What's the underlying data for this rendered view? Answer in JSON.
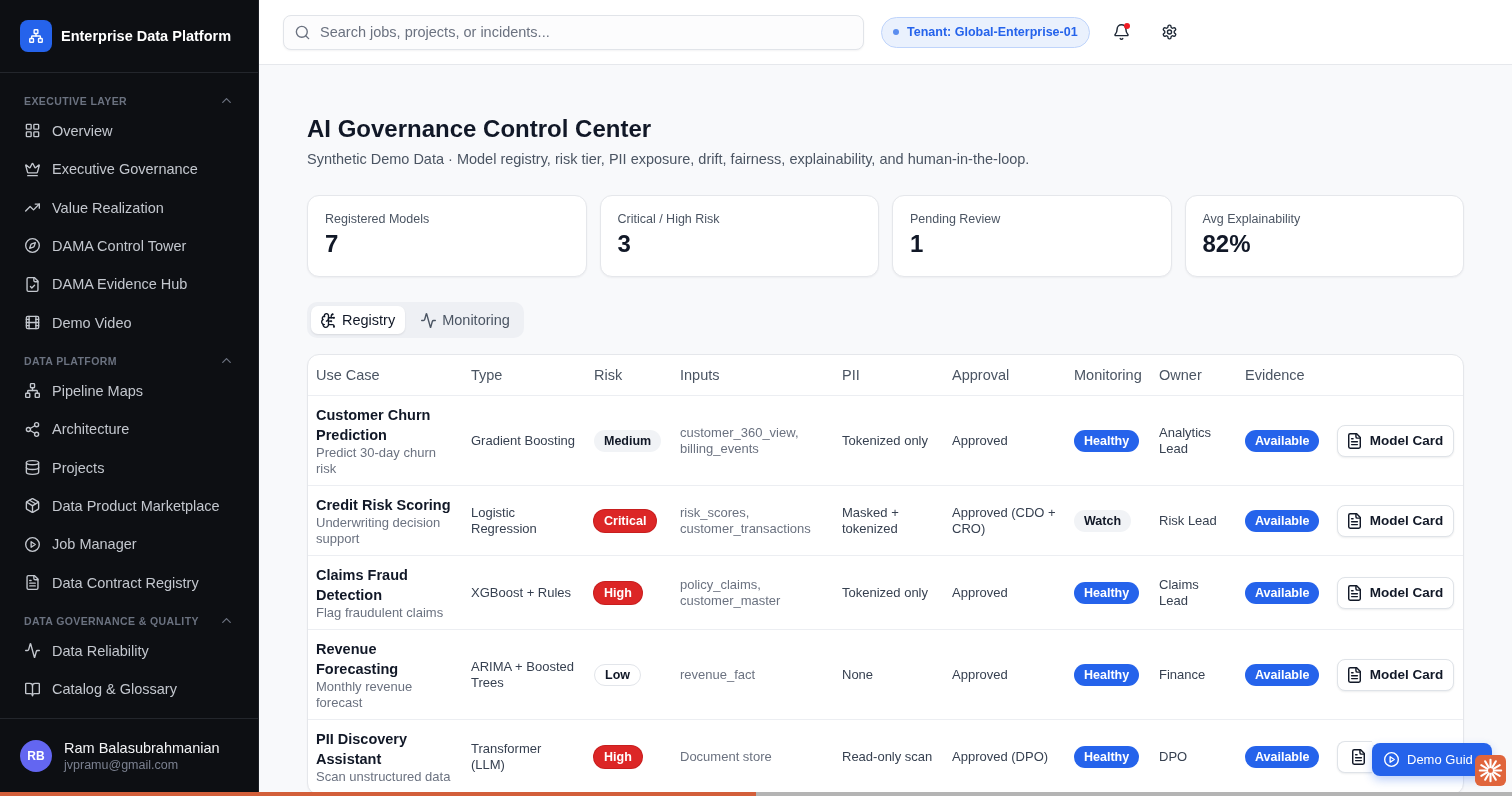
{
  "sidebar": {
    "brand": "Enterprise Data Platform",
    "sections": [
      {
        "title": "EXECUTIVE LAYER",
        "expanded": true,
        "items": [
          {
            "label": "Overview",
            "selected": false
          },
          {
            "label": "Executive Governance",
            "selected": false
          },
          {
            "label": "Value Realization",
            "selected": false
          },
          {
            "label": "DAMA Control Tower",
            "selected": false
          },
          {
            "label": "DAMA Evidence Hub",
            "selected": false
          },
          {
            "label": "Demo Video",
            "selected": false
          }
        ]
      },
      {
        "title": "DATA PLATFORM",
        "expanded": true,
        "items": [
          {
            "label": "Pipeline Maps",
            "selected": false
          },
          {
            "label": "Architecture",
            "selected": false
          },
          {
            "label": "Projects",
            "selected": false
          },
          {
            "label": "Data Product Marketplace",
            "selected": false
          },
          {
            "label": "Job Manager",
            "selected": false
          },
          {
            "label": "Data Contract Registry",
            "selected": false
          }
        ]
      },
      {
        "title": "DATA GOVERNANCE & QUALITY",
        "expanded": true,
        "items": [
          {
            "label": "Data Reliability",
            "selected": false
          },
          {
            "label": "Catalog & Glossary",
            "selected": false
          }
        ]
      }
    ],
    "user": {
      "initials": "RB",
      "name": "Ram Balasubrahmanian",
      "email": "jvpramu@gmail.com"
    }
  },
  "topbar": {
    "search": {
      "placeholder": "Search jobs, projects, or incidents..."
    },
    "tenant": "Tenant: Global-Enterprise-01",
    "notifications": {
      "unread": true
    }
  },
  "page": {
    "title": "AI Governance Control Center",
    "subtitle": "Synthetic Demo Data · Model registry, risk tier, PII exposure, drift, fairness, explainability, and human-in-the-loop."
  },
  "stats": [
    {
      "label": "Registered Models",
      "value": "7"
    },
    {
      "label": "Critical / High Risk",
      "value": "3"
    },
    {
      "label": "Pending Review",
      "value": "1"
    },
    {
      "label": "Avg Explainability",
      "value": "82%"
    }
  ],
  "tabs": [
    {
      "label": "Registry",
      "selected": true
    },
    {
      "label": "Monitoring",
      "selected": false
    }
  ],
  "table": {
    "columns": [
      "Use Case",
      "Type",
      "Risk",
      "Inputs",
      "PII",
      "Approval",
      "Monitoring",
      "Owner",
      "Evidence"
    ],
    "rows": [
      {
        "use_case": {
          "title": "Customer Churn Prediction",
          "description": "Predict 30-day churn risk"
        },
        "type": "Gradient Boosting",
        "risk": {
          "label": "Medium",
          "kind": "muted"
        },
        "inputs": "customer_360_view, billing_events",
        "pii": "Tokenized only",
        "approval": "Approved",
        "monitoring": {
          "label": "Healthy",
          "kind": "primary"
        },
        "owner": "Analytics Lead",
        "evidence": {
          "label": "Available",
          "kind": "primary"
        },
        "action": "Model Card"
      },
      {
        "use_case": {
          "title": "Credit Risk Scoring",
          "description": "Underwriting decision support"
        },
        "type": "Logistic Regression",
        "risk": {
          "label": "Critical",
          "kind": "danger"
        },
        "inputs": "risk_scores, customer_transactions",
        "pii": "Masked + tokenized",
        "approval": "Approved (CDO + CRO)",
        "monitoring": {
          "label": "Watch",
          "kind": "muted"
        },
        "owner": "Risk Lead",
        "evidence": {
          "label": "Available",
          "kind": "primary"
        },
        "action": "Model Card"
      },
      {
        "use_case": {
          "title": "Claims Fraud Detection",
          "description": "Flag fraudulent claims"
        },
        "type": "XGBoost + Rules",
        "risk": {
          "label": "High",
          "kind": "danger"
        },
        "inputs": "policy_claims, customer_master",
        "pii": "Tokenized only",
        "approval": "Approved",
        "monitoring": {
          "label": "Healthy",
          "kind": "primary"
        },
        "owner": "Claims Lead",
        "evidence": {
          "label": "Available",
          "kind": "primary"
        },
        "action": "Model Card"
      },
      {
        "use_case": {
          "title": "Revenue Forecasting",
          "description": "Monthly revenue forecast"
        },
        "type": "ARIMA + Boosted Trees",
        "risk": {
          "label": "Low",
          "kind": "outline"
        },
        "inputs": "revenue_fact",
        "pii": "None",
        "approval": "Approved",
        "monitoring": {
          "label": "Healthy",
          "kind": "primary"
        },
        "owner": "Finance",
        "evidence": {
          "label": "Available",
          "kind": "primary"
        },
        "action": "Model Card"
      },
      {
        "use_case": {
          "title": "PII Discovery Assistant",
          "description": "Scan unstructured data"
        },
        "type": "Transformer (LLM)",
        "risk": {
          "label": "High",
          "kind": "danger"
        },
        "inputs": "Document store",
        "pii": "Read-only scan",
        "approval": "Approved (DPO)",
        "monitoring": {
          "label": "Healthy",
          "kind": "primary"
        },
        "owner": "DPO",
        "evidence": {
          "label": "Available",
          "kind": "primary"
        }
      }
    ]
  },
  "demo_guide": {
    "label": "Demo Guid"
  },
  "progress": {
    "level": 0.5
  }
}
